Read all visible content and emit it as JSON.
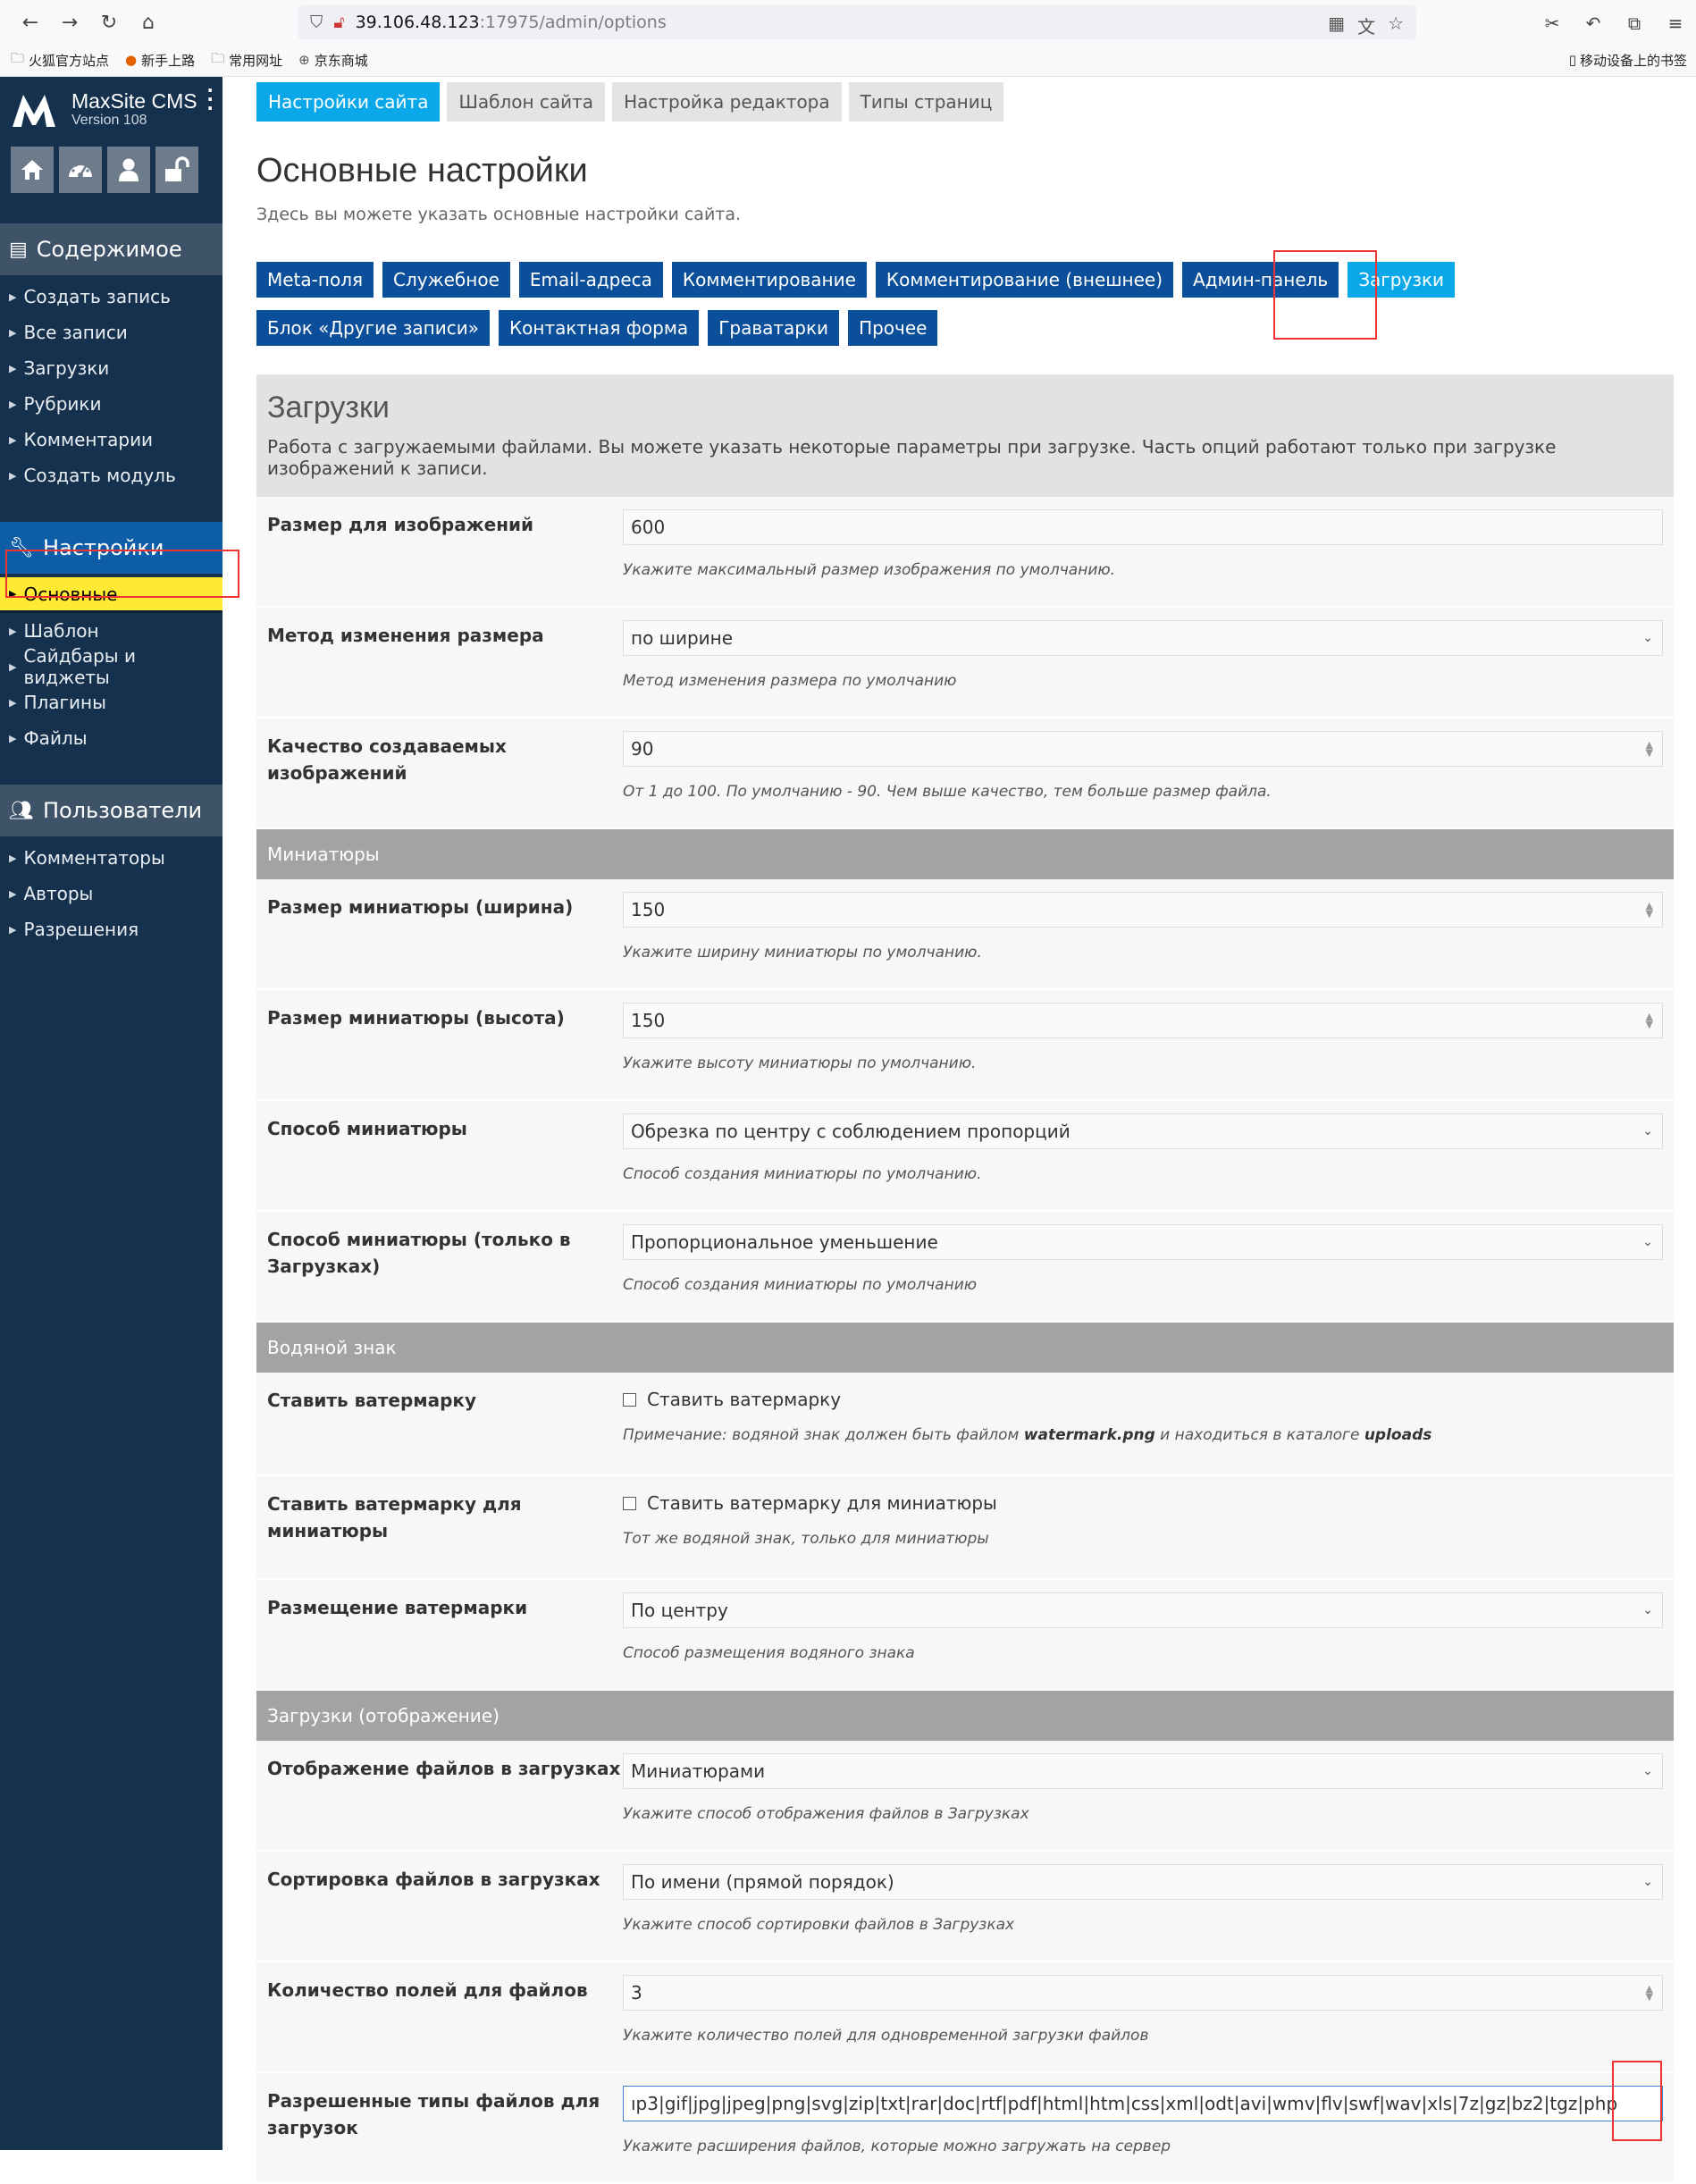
{
  "browser": {
    "url_host": "39.106.48.123",
    "url_path": ":17975/admin/options",
    "bookmarks": [
      "火狐官方站点",
      "新手上路",
      "常用网址",
      "京东商城"
    ],
    "mobile_bookmarks": "移动设备上的书签"
  },
  "brand": {
    "name": "MaxSite CMS",
    "version": "Version 108"
  },
  "sidebar": {
    "content_title": "Содержимое",
    "content_items": [
      "Создать запись",
      "Все записи",
      "Загрузки",
      "Рубрики",
      "Комментарии",
      "Создать модуль"
    ],
    "settings_title": "Настройки",
    "settings_items": [
      "Основные",
      "Шаблон",
      "Сайдбары и виджеты",
      "Плагины",
      "Файлы"
    ],
    "users_title": "Пользователи",
    "users_items": [
      "Комментаторы",
      "Авторы",
      "Разрешения"
    ]
  },
  "topnav": [
    "Настройки сайта",
    "Шаблон сайта",
    "Настройка редактора",
    "Типы страниц"
  ],
  "page": {
    "title": "Основные настройки",
    "lead": "Здесь вы можете указать основные настройки сайта."
  },
  "subnav": [
    "Meta-поля",
    "Служебное",
    "Email-адреса",
    "Комментирование",
    "Комментирование (внешнее)",
    "Админ-панель",
    "Загрузки",
    "Блок «Другие записи»",
    "Контактная форма",
    "Граватарки",
    "Прочее"
  ],
  "panel": {
    "title": "Загрузки",
    "desc": "Работа с загружаемыми файлами. Вы можете указать некоторые параметры при загрузке. Часть опций работают только при загрузке изображений к записи."
  },
  "fields": {
    "img_size": {
      "label": "Размер для изображений",
      "value": "600",
      "hint": "Укажите максимальный размер изображения по умолчанию."
    },
    "resize_method": {
      "label": "Метод изменения размера",
      "value": "по ширине",
      "hint": "Метод изменения размера по умолчанию"
    },
    "quality": {
      "label": "Качество создаваемых изображений",
      "value": "90",
      "hint": "От 1 до 100. По умолчанию - 90. Чем выше качество, тем больше размер файла."
    },
    "group_thumbs": "Миниатюры",
    "thumb_w": {
      "label": "Размер миниатюры (ширина)",
      "value": "150",
      "hint": "Укажите ширину миниатюры по умолчанию."
    },
    "thumb_h": {
      "label": "Размер миниатюры (высота)",
      "value": "150",
      "hint": "Укажите высоту миниатюры по умолчанию."
    },
    "thumb_way": {
      "label": "Способ миниатюры",
      "value": "Обрезка по центру с соблюдением пропорций",
      "hint": "Способ создания миниатюры по умолчанию."
    },
    "thumb_way_up": {
      "label": "Способ миниатюры (только в Загрузках)",
      "value": "Пропорциональное уменьшение",
      "hint": "Способ создания миниатюры по умолчанию"
    },
    "group_watermark": "Водяной знак",
    "wm": {
      "label": "Ставить ватермарку",
      "check": "Ставить ватермарку",
      "hint_pre": "Примечание: водяной знак должен быть файлом ",
      "hint_file": "watermark.png",
      "hint_mid": " и находиться в каталоге ",
      "hint_dir": "uploads"
    },
    "wm_thumb": {
      "label": "Ставить ватермарку для миниатюры",
      "check": "Ставить ватермарку для миниатюры",
      "hint": "Тот же водяной знак, только для миниатюры"
    },
    "wm_pos": {
      "label": "Размещение ватермарки",
      "value": "По центру",
      "hint": "Способ размещения водяного знака"
    },
    "group_display": "Загрузки (отображение)",
    "display": {
      "label": "Отображение файлов в загрузках",
      "value": "Миниатюрами",
      "hint": "Укажите способ отображения файлов в Загрузках"
    },
    "sort": {
      "label": "Сортировка файлов в загрузках",
      "value": "По имени (прямой порядок)",
      "hint": "Укажите способ сортировки файлов в Загрузках"
    },
    "count": {
      "label": "Количество полей для файлов",
      "value": "3",
      "hint": "Укажите количество полей для одновременной загрузки файлов"
    },
    "types": {
      "label": "Разрешенные типы файлов для загрузок",
      "value": "ıp3|gif|jpg|jpeg|png|svg|zip|txt|rar|doc|rtf|pdf|html|htm|css|xml|odt|avi|wmv|flv|swf|wav|xls|7z|gz|bz2|tgz|php",
      "hint": "Укажите расширения файлов, которые можно загружать на сервер"
    }
  }
}
